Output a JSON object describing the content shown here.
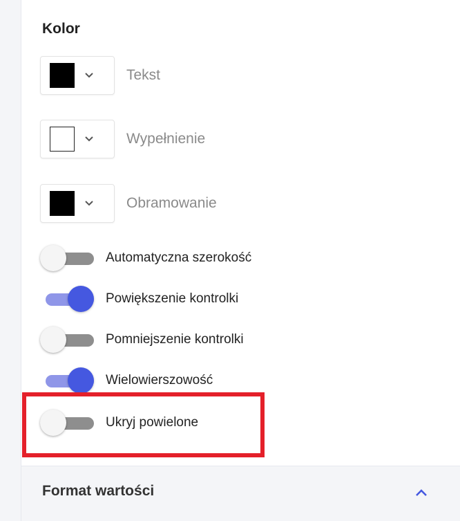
{
  "section": {
    "title": "Kolor"
  },
  "colors": [
    {
      "label": "Tekst",
      "swatch": "#000000"
    },
    {
      "label": "Wypełnienie",
      "swatch": "#ffffff"
    },
    {
      "label": "Obramowanie",
      "swatch": "#000000"
    }
  ],
  "toggles": [
    {
      "label": "Automatyczna szerokość",
      "on": false
    },
    {
      "label": "Powiększenie kontrolki",
      "on": true
    },
    {
      "label": "Pomniejszenie kontrolki",
      "on": false
    },
    {
      "label": "Wielowierszowość",
      "on": true
    },
    {
      "label": "Ukryj powielone",
      "on": false
    }
  ],
  "footer": {
    "title": "Format wartości"
  },
  "theme": {
    "accent": "#4558e0",
    "accent_track": "#8f96e8",
    "highlight": "#e4202a",
    "icons": [
      "chevron-down-icon",
      "chevron-up-icon"
    ]
  }
}
